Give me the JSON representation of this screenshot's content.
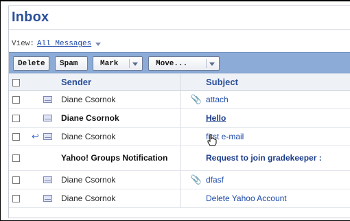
{
  "page": {
    "title": "Inbox"
  },
  "view": {
    "label": "View:",
    "value": "All Messages"
  },
  "toolbar": {
    "delete": "Delete",
    "spam": "Spam",
    "mark": "Mark",
    "move": "Move..."
  },
  "columns": {
    "sender": "Sender",
    "subject": "Subject"
  },
  "messages": [
    {
      "sender": "Diane Csornok",
      "subject": "attach",
      "unread": false,
      "replied": false,
      "attachment": true
    },
    {
      "sender": "Diane Csornok",
      "subject": "Hello",
      "unread": true,
      "replied": false,
      "attachment": false
    },
    {
      "sender": "Diane Csornok",
      "subject": "first e-mail",
      "unread": false,
      "replied": true,
      "attachment": false
    },
    {
      "sender": "Yahoo! Groups Notification",
      "subject": "Request to join gradekeeper :",
      "unread": true,
      "replied": false,
      "attachment": false
    },
    {
      "sender": "Diane Csornok",
      "subject": "dfasf",
      "unread": false,
      "replied": false,
      "attachment": true
    },
    {
      "sender": "Diane Csornok",
      "subject": "Delete Yahoo Account",
      "unread": false,
      "replied": false,
      "attachment": false
    }
  ]
}
